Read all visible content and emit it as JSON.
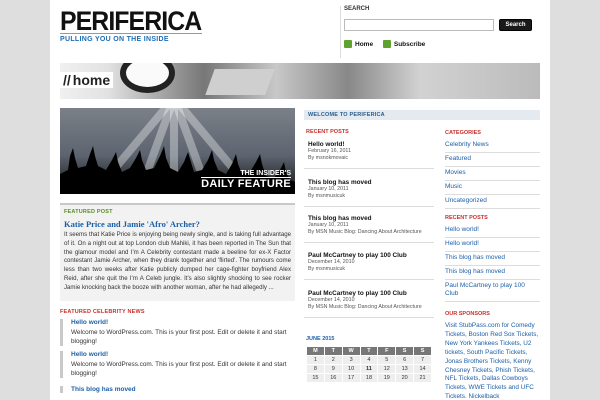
{
  "header": {
    "logo": "PERIFERICA",
    "tagline": "PULLING YOU ON THE INSIDE",
    "search_label": "SEARCH",
    "search_value": "",
    "search_button": "Search",
    "links": [
      "Home",
      "Subscribe"
    ]
  },
  "banner": {
    "slashes": "//",
    "title": "home"
  },
  "feature": {
    "caption_top": "THE INSIDER'S",
    "caption_big": "DAILY FEATURE"
  },
  "featured_post": {
    "label": "FEATURED POST",
    "title": "Katie Price and Jamie 'Afro' Archer?",
    "text": "It seems that Katie Price is enjoying being newly single, and is taking full advantage of it. On a night out at top London club Mahiki, it has been reported in The Sun that the glamour model and I'm A Celebrity contestant made a beeline for ex-X Factor contestant Jamie Archer, when they drank together and 'flirted'. The rumours come less than two weeks after Katie publicly dumped her cage-fighter boyfriend Alex Reid, after she quit the I'm A Celeb jungle. It's also slightly shocking to see rocker Jamie knocking back the booze with another woman, after he had allegedly ..."
  },
  "celebrity_news": {
    "label": "FEATURED CELEBRITY NEWS",
    "items": [
      {
        "title": "Hello world!",
        "text": "Welcome to WordPress.com. This is your first post. Edit or delete it and start blogging!"
      },
      {
        "title": "Hello world!",
        "text": "Welcome to WordPress.com. This is your first post. Edit or delete it and start blogging!"
      },
      {
        "title": "This blog has moved",
        "text": ""
      }
    ]
  },
  "middle": {
    "heading": "WELCOME TO PERIFERICA",
    "recent_label": "RECENT POSTS",
    "posts": [
      {
        "title": "Hello world!",
        "date": "February 16, 2011",
        "by": "By msnokmovaic"
      },
      {
        "title": "This blog has moved",
        "date": "January 10, 2011",
        "by": "By msnmusicuk"
      },
      {
        "title": "This blog has moved",
        "date": "January 10, 2011",
        "by": "By MSN Music Blog: Dancing About Architecture"
      },
      {
        "title": "Paul McCartney to play 100 Club",
        "date": "December 14, 2010",
        "by": "By msnmusicuk"
      },
      {
        "title": "Paul McCartney to play 100 Club",
        "date": "December 14, 2010",
        "by": "By MSN Music Blog: Dancing About Architecture"
      }
    ],
    "calendar_label": "JUNE 2015",
    "calendar_headers": [
      "M",
      "T",
      "W",
      "T",
      "F",
      "S",
      "S"
    ],
    "calendar_rows": [
      [
        "1",
        "2",
        "3",
        "4",
        "5",
        "6",
        "7"
      ],
      [
        "8",
        "9",
        "10",
        "11",
        "12",
        "13",
        "14"
      ],
      [
        "15",
        "16",
        "17",
        "18",
        "19",
        "20",
        "21"
      ]
    ]
  },
  "right": {
    "categories_label": "CATEGORIES",
    "categories": [
      "Celebrity News",
      "Featured",
      "Movies",
      "Music",
      "Uncategorized"
    ],
    "recent_label": "RECENT POSTS",
    "recent": [
      "Hello world!",
      "Hello world!",
      "This blog has moved",
      "This blog has moved",
      "Paul McCartney to play 100 Club"
    ],
    "sponsors_label": "OUR SPONSORS",
    "sponsors_text": "Visit StubPass.com for Comedy Tickets, Boston Red Sox Tickets, New York Yankees Tickets, U2 tickets, South Pacific Tickets, Jonas Brothers Tickets, Kenny Chesney Tickets, Phish Tickets, NFL Tickets, Dallas Cowboys Tickets, WWE Tickets and UFC Tickets. Nickelback"
  },
  "colors": {
    "accent_blue": "#1c6db5",
    "accent_red": "#c8302c",
    "accent_green": "#5a8f24"
  }
}
